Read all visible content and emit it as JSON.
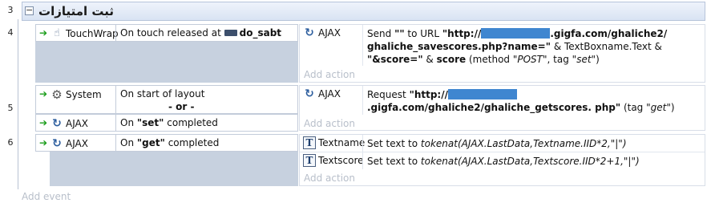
{
  "group": {
    "row_number": "3",
    "title": "ثبت امتیازات",
    "collapse_symbol": "−"
  },
  "events": [
    {
      "row_number": "4",
      "conditions": [
        {
          "object": "TouchWrap",
          "icon": "touch-icon",
          "text_pre": "On touch released at",
          "kbd_icon": "keyboard-icon",
          "text_bold": "do_sabt"
        }
      ],
      "actions": [
        {
          "object": "AJAX",
          "icon": "ajax-icon",
          "parts": {
            "p1": "Send",
            "p2": "\"\"",
            "p3": "to URL",
            "p4": "\"http://",
            "p5": ".gigfa.com/ghaliche2/",
            "p6": "ghaliche_savescores.php?name=\"",
            "p7": "& TextBoxname.Text &",
            "p8": "\"&score=\"",
            "p9": "&",
            "p10": "score",
            "p11": "(method",
            "p12": "\"POST\"",
            "p13": ", tag",
            "p14": "\"set\"",
            "p15": ")"
          }
        }
      ],
      "add_action": "Add action"
    },
    {
      "row_number": "5",
      "conditions": [
        {
          "object": "System",
          "icon": "gear-icon",
          "text": "On start of layout"
        },
        {
          "object": "AJAX",
          "icon": "ajax-icon",
          "text_pre": "On",
          "text_bold": "\"set\"",
          "text_post": "completed"
        }
      ],
      "or_label": "- or -",
      "actions": [
        {
          "object": "AJAX",
          "icon": "ajax-icon",
          "parts": {
            "p1": "Request",
            "p2": "\"http://",
            "p3": ".gigfa.com/ghaliche2/ghaliche_getscores.",
            "p4": "php\"",
            "p5": "(tag",
            "p6": "\"get\"",
            "p7": ")"
          }
        }
      ],
      "add_action": "Add action"
    },
    {
      "row_number": "6",
      "conditions": [
        {
          "object": "AJAX",
          "icon": "ajax-icon",
          "text_pre": "On",
          "text_bold": "\"get\"",
          "text_post": "completed"
        }
      ],
      "actions": [
        {
          "object": "Textname",
          "icon": "text-object-icon",
          "text_pre": "Set text to",
          "text_italic": "tokenat(AJAX.LastData,Textname.IID*2,\"|\")"
        },
        {
          "object": "Textscore",
          "icon": "text-object-icon",
          "text_pre": "Set text to",
          "text_italic": "tokenat(AJAX.LastData,Textscore.IID*2+1,\"|\")"
        }
      ],
      "add_action": "Add action"
    }
  ],
  "add_event": "Add event",
  "colors": {
    "redaction": "#3f86d0",
    "condition_arrow": "#1a9c1a",
    "placeholder_text": "#b8bfca"
  }
}
